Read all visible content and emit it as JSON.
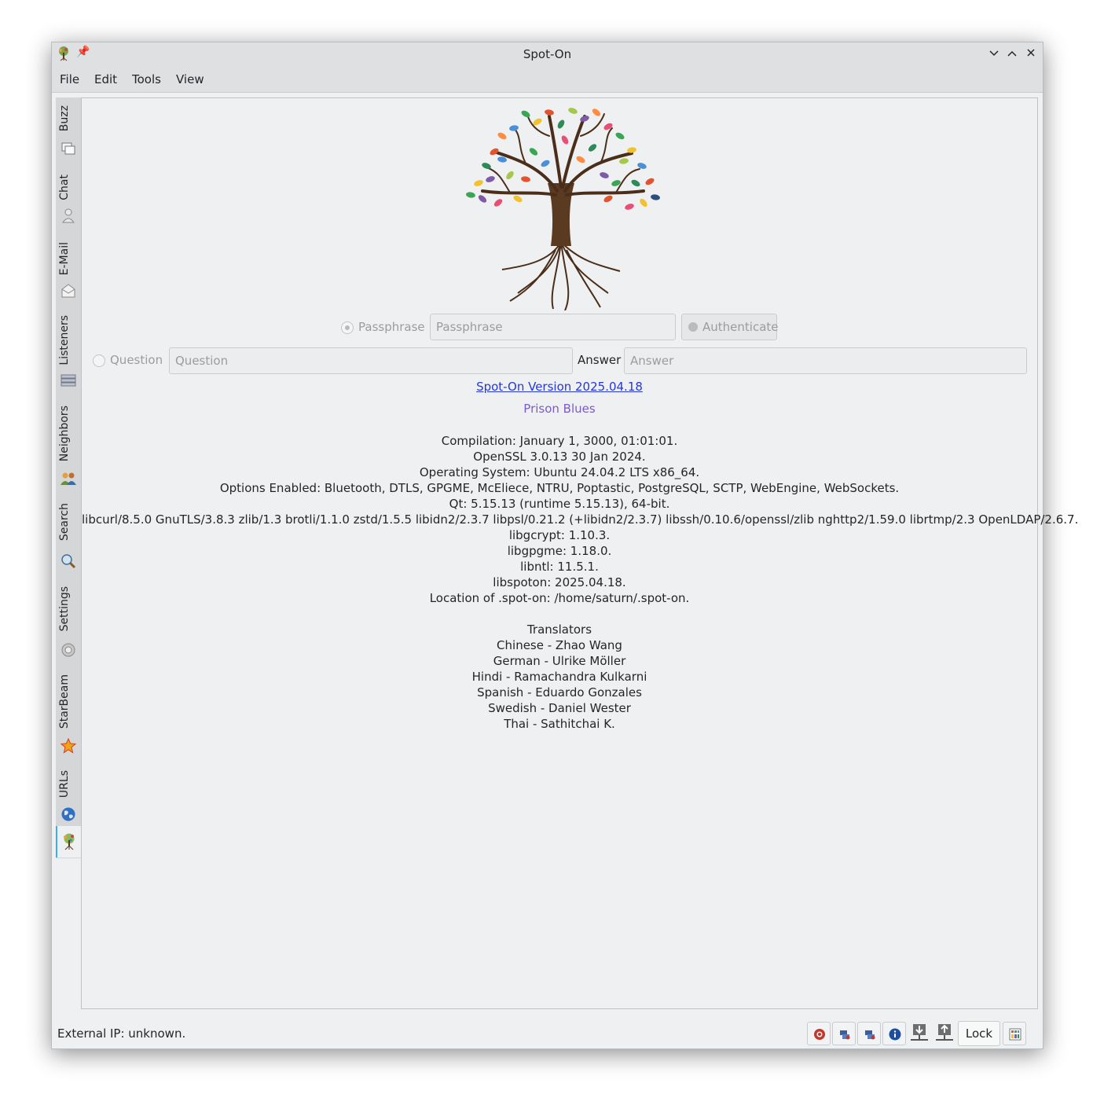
{
  "window": {
    "title": "Spot-On"
  },
  "menu": [
    "File",
    "Edit",
    "Tools",
    "View"
  ],
  "side_tabs": [
    {
      "label": "Buzz",
      "icon": "buzz-icon"
    },
    {
      "label": "Chat",
      "icon": "person-icon"
    },
    {
      "label": "E-Mail",
      "icon": "envelope-icon"
    },
    {
      "label": "Listeners",
      "icon": "server-icon"
    },
    {
      "label": "Neighbors",
      "icon": "people-icon"
    },
    {
      "label": "Search",
      "icon": "magnifier-icon"
    },
    {
      "label": "Settings",
      "icon": "gear-icon"
    },
    {
      "label": "StarBeam",
      "icon": "star-icon"
    },
    {
      "label": "URLs",
      "icon": "globe-icon"
    }
  ],
  "active_tab_icon": "tree-icon",
  "auth": {
    "passphrase_radio": "Passphrase",
    "passphrase_placeholder": "Passphrase",
    "authenticate_button": "Authenticate",
    "question_radio": "Question",
    "question_placeholder": "Question",
    "answer_label": "Answer",
    "answer_placeholder": "Answer"
  },
  "version_link": "Spot-On Version 2025.04.18",
  "release_name": "Prison Blues",
  "info_lines": [
    "Compilation: January 1, 3000, 01:01:01.",
    "OpenSSL 3.0.13 30 Jan 2024.",
    "Operating System: Ubuntu 24.04.2 LTS x86_64.",
    "Options Enabled: Bluetooth, DTLS, GPGME, McEliece, NTRU, Poptastic, PostgreSQL, SCTP, WebEngine, WebSockets.",
    "Qt: 5.15.13 (runtime 5.15.13), 64-bit.",
    "libcurl/8.5.0 GnuTLS/3.8.3 zlib/1.3 brotli/1.1.0 zstd/1.5.5 libidn2/2.3.7 libpsl/0.21.2 (+libidn2/2.3.7) libssh/0.10.6/openssl/zlib nghttp2/1.59.0 librtmp/2.3 OpenLDAP/2.6.7.",
    "libgcrypt: 1.10.3.",
    "libgpgme: 1.18.0.",
    "libntl: 11.5.1.",
    "libspoton: 2025.04.18.",
    "Location of .spot-on: /home/saturn/.spot-on."
  ],
  "translators_title": "Translators",
  "translators": [
    "Chinese - Zhao Wang",
    "German - Ulrike Möller",
    "Hindi - Ramachandra Kulkarni",
    "Spanish - Eduardo Gonzales",
    "Swedish - Daniel Wester",
    "Thai - Sathitchai K."
  ],
  "status": {
    "external_ip": "External IP: unknown.",
    "lock_button": "Lock",
    "icons": [
      "kernel-status-icon",
      "buzz-status-icon",
      "listeners-status-icon",
      "info-icon",
      "download-icon",
      "upload-icon",
      "chart-icon"
    ]
  },
  "colors": {
    "accent": "#3daee9",
    "link": "#2637d6",
    "release": "#7a5cc8"
  }
}
